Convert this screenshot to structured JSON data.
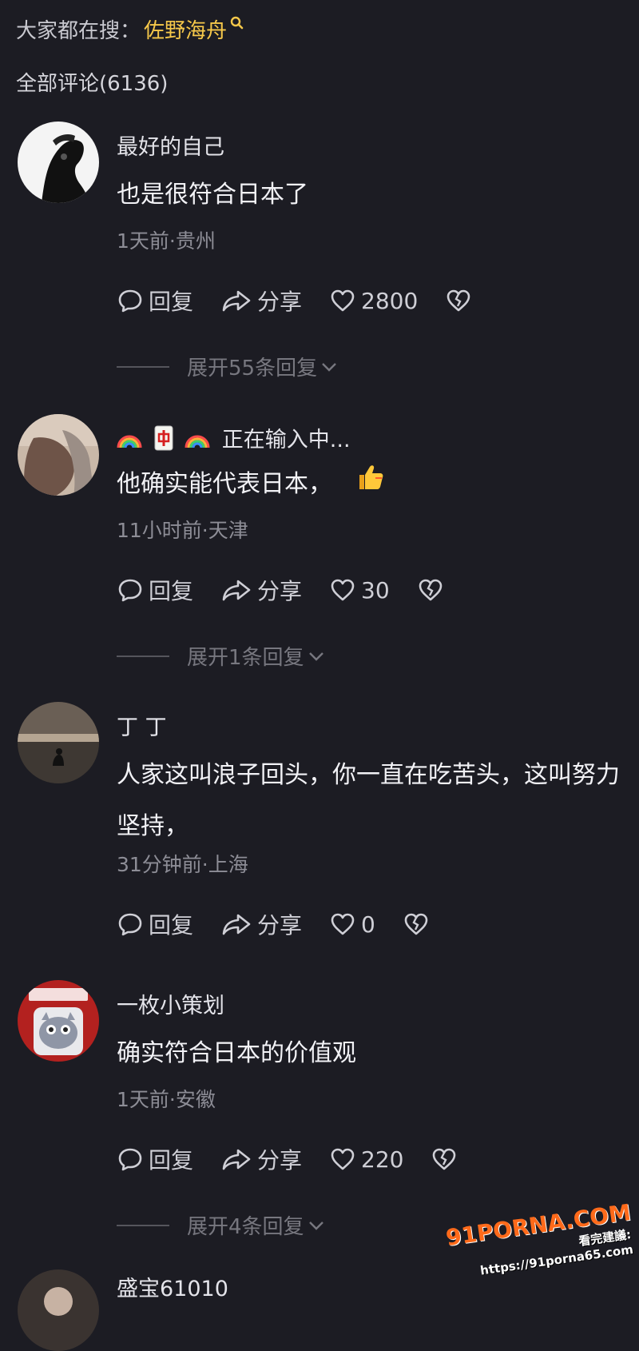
{
  "header": {
    "hot_search_label": "大家都在搜：",
    "hot_search_term": "佐野海舟",
    "comment_count_label": "全部评论(6136)"
  },
  "comments": [
    {
      "username": "最好的自己",
      "content": "也是很符合日本了",
      "meta": "1天前·贵州",
      "reply_label": "回复",
      "share_label": "分享",
      "likes": "2800",
      "expand_label": "展开55条回复"
    },
    {
      "username": "正在输入中...",
      "content": "他确实能代表日本，",
      "meta": "11小时前·天津",
      "reply_label": "回复",
      "share_label": "分享",
      "likes": "30",
      "expand_label": "展开1条回复"
    },
    {
      "username": "丁 丁",
      "content": "人家这叫浪子回头，你一直在吃苦头，这叫努力坚持，",
      "meta": "31分钟前·上海",
      "reply_label": "回复",
      "share_label": "分享",
      "likes": "0"
    },
    {
      "username": "一枚小策划",
      "content": "确实符合日本的价值观",
      "meta": "1天前·安徽",
      "reply_label": "回复",
      "share_label": "分享",
      "likes": "220",
      "expand_label": "展开4条回复"
    },
    {
      "username": "盛宝61010"
    }
  ],
  "watermark": {
    "logo": "91PORNA.COM",
    "url": "看完建議: https://91porna65.com"
  },
  "colors": {
    "background": "#1c1c23",
    "accent_search": "#f6c84a",
    "meta_gray": "#8d8d96"
  }
}
